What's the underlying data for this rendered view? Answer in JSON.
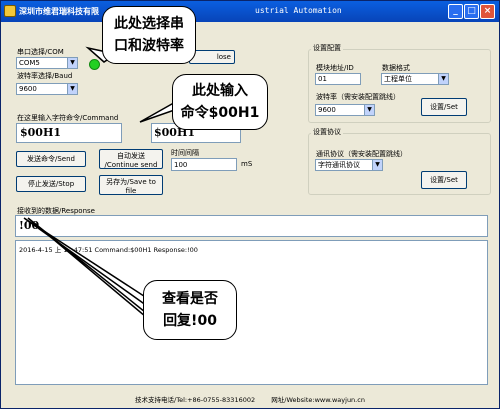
{
  "title_left": "深圳市维君瑞科技有限",
  "title_right": "ustrial Automation",
  "close_btn_partial": "lose",
  "port_label": "串口选择/COM",
  "port_value": "COM5",
  "baud_label": "波特率选择/Baud",
  "baud_value": "9600",
  "cmd_label": "在这里输入字符命令/Command",
  "cmd_value": "$00H1",
  "cmd_value2": "$00H1",
  "send_btn": "发送命令/Send",
  "auto_send_btn_line1": "自动发送",
  "auto_send_btn_line2": "/Continue send",
  "interval_label": "时间间隔",
  "interval_value": "100",
  "interval_unit": "mS",
  "stop_btn": "停止发送/Stop",
  "save_btn_line1": "另存为/Save to",
  "save_btn_line2": "file",
  "config_group": "设置配置",
  "module_addr_label": "模块地址/ID",
  "module_addr_value": "01",
  "data_format_label": "数据格式",
  "data_format_value": "工程单位",
  "cfg_baud_label": "波特率（需安装配置跳线）",
  "cfg_baud_value": "9600",
  "set_btn1": "设置/Set",
  "protocol_group": "设置协议",
  "protocol_label": "通讯协议（需安装配置跳线）",
  "protocol_value": "字符通讯协议",
  "set_btn2": "设置/Set",
  "recv_label": "接收到的数据/Response",
  "recv_value": "!00",
  "log_line": "2016-4-15 上  10:47:51   Command:$00H1   Response:!00",
  "footer_phone": "技术支持电话/Tel:+86-0755-83316002",
  "footer_site": "网址/Website:www.wayjun.cn",
  "callout1_line1": "此处选择串",
  "callout1_line2": "口和波特率",
  "callout2_line1": "此处输入",
  "callout2_line2": "命令$00H1",
  "callout3_line1": "查看是否",
  "callout3_line2": "回复!00"
}
